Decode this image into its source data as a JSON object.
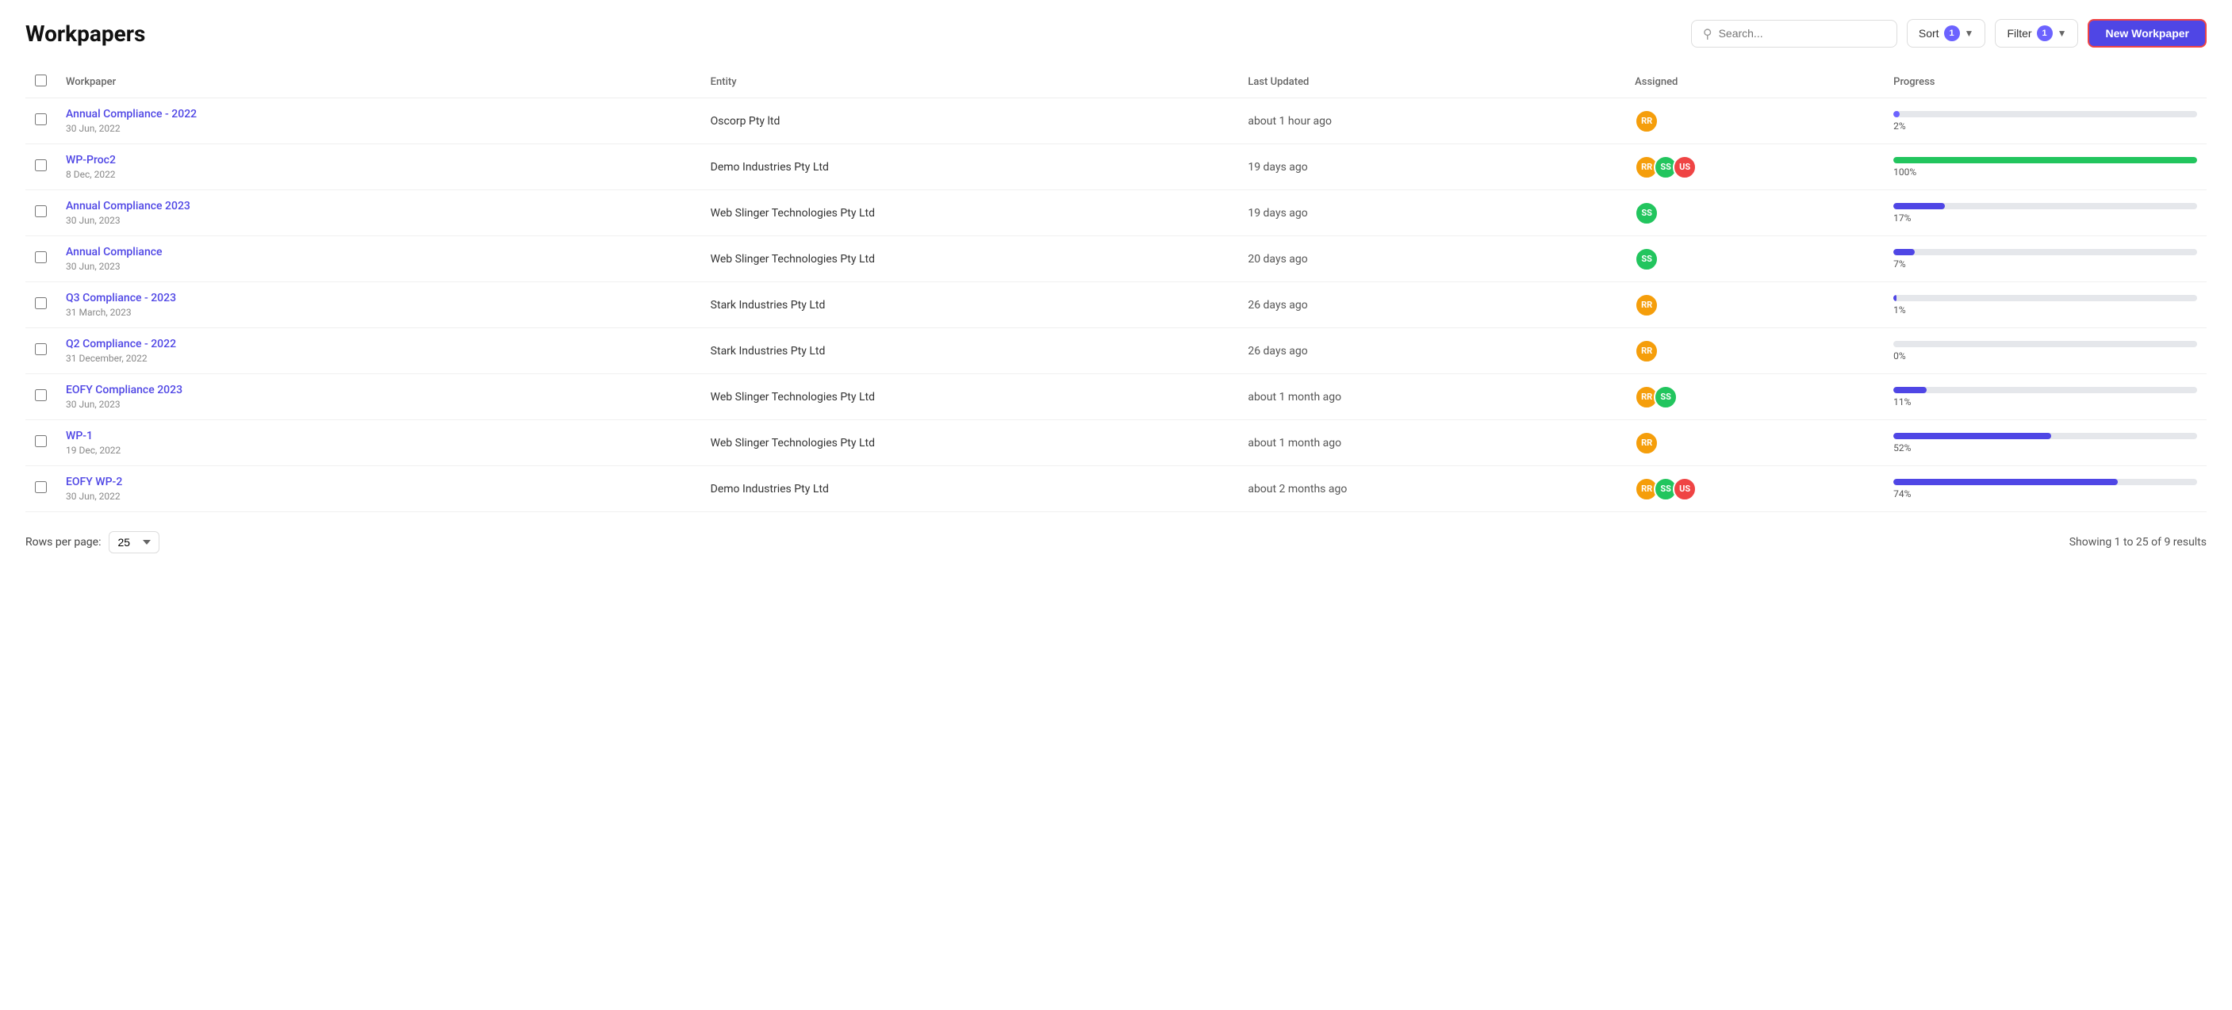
{
  "page": {
    "title": "Workpapers"
  },
  "search": {
    "placeholder": "Search..."
  },
  "controls": {
    "sort_label": "Sort",
    "sort_count": "1",
    "filter_label": "Filter",
    "filter_count": "1",
    "new_button": "New Workpaper"
  },
  "table": {
    "columns": [
      "",
      "Workpaper",
      "Entity",
      "Last Updated",
      "Assigned",
      "Progress"
    ],
    "rows": [
      {
        "id": 1,
        "name": "Annual Compliance - 2022",
        "date": "30 Jun, 2022",
        "entity": "Oscorp Pty ltd",
        "last_updated": "about 1 hour ago",
        "assignees": [
          "RR"
        ],
        "assignee_types": [
          "rr"
        ],
        "progress": 2,
        "progress_color": "#6c63ff"
      },
      {
        "id": 2,
        "name": "WP-Proc2",
        "date": "8 Dec, 2022",
        "entity": "Demo Industries Pty Ltd",
        "last_updated": "19 days ago",
        "assignees": [
          "RR",
          "SS",
          "US"
        ],
        "assignee_types": [
          "rr",
          "ss",
          "us"
        ],
        "progress": 100,
        "progress_color": "#22c55e"
      },
      {
        "id": 3,
        "name": "Annual Compliance 2023",
        "date": "30 Jun, 2023",
        "entity": "Web Slinger Technologies Pty Ltd",
        "last_updated": "19 days ago",
        "assignees": [
          "SS"
        ],
        "assignee_types": [
          "ss"
        ],
        "progress": 17,
        "progress_color": "#4f46e5"
      },
      {
        "id": 4,
        "name": "Annual Compliance",
        "date": "30 Jun, 2023",
        "entity": "Web Slinger Technologies Pty Ltd",
        "last_updated": "20 days ago",
        "assignees": [
          "SS"
        ],
        "assignee_types": [
          "ss"
        ],
        "progress": 7,
        "progress_color": "#4f46e5"
      },
      {
        "id": 5,
        "name": "Q3 Compliance - 2023",
        "date": "31 March, 2023",
        "entity": "Stark Industries Pty Ltd",
        "last_updated": "26 days ago",
        "assignees": [
          "RR"
        ],
        "assignee_types": [
          "rr"
        ],
        "progress": 1,
        "progress_color": "#4f46e5"
      },
      {
        "id": 6,
        "name": "Q2 Compliance - 2022",
        "date": "31 December, 2022",
        "entity": "Stark Industries Pty Ltd",
        "last_updated": "26 days ago",
        "assignees": [
          "RR"
        ],
        "assignee_types": [
          "rr"
        ],
        "progress": 0,
        "progress_color": "#4f46e5"
      },
      {
        "id": 7,
        "name": "EOFY Compliance 2023",
        "date": "30 Jun, 2023",
        "entity": "Web Slinger Technologies Pty Ltd",
        "last_updated": "about 1 month ago",
        "assignees": [
          "RR",
          "SS"
        ],
        "assignee_types": [
          "rr",
          "ss"
        ],
        "progress": 11,
        "progress_color": "#4f46e5"
      },
      {
        "id": 8,
        "name": "WP-1",
        "date": "19 Dec, 2022",
        "entity": "Web Slinger Technologies Pty Ltd",
        "last_updated": "about 1 month ago",
        "assignees": [
          "RR"
        ],
        "assignee_types": [
          "rr"
        ],
        "progress": 52,
        "progress_color": "#4f46e5"
      },
      {
        "id": 9,
        "name": "EOFY WP-2",
        "date": "30 Jun, 2022",
        "entity": "Demo Industries Pty Ltd",
        "last_updated": "about 2 months ago",
        "assignees": [
          "RR",
          "SS",
          "US"
        ],
        "assignee_types": [
          "rr",
          "ss",
          "us"
        ],
        "progress": 74,
        "progress_color": "#4f46e5"
      }
    ]
  },
  "footer": {
    "rows_per_page_label": "Rows per page:",
    "rows_per_page_value": "25",
    "showing_text": "Showing 1 to 25 of 9 results"
  }
}
